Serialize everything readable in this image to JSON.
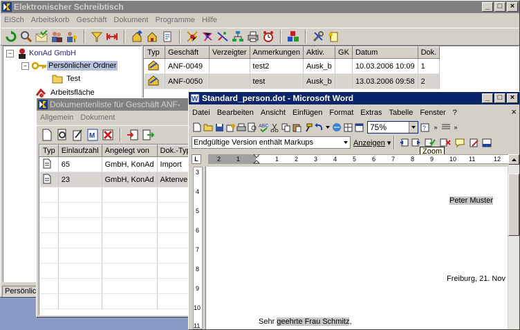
{
  "main_window": {
    "title": "Elektronischer Schreibtisch",
    "menu": [
      "EiSch",
      "Arbeitskorb",
      "Geschäft",
      "Dokument",
      "Programme",
      "Hilfe"
    ],
    "toolbar_icons": [
      "refresh-icon",
      "search-icon",
      "mail-check-icon",
      "users-icon",
      "users-key-icon",
      "filter-icon",
      "expand-width-icon",
      "house-up-icon",
      "house-icon",
      "document-icon",
      "rays-icon",
      "network-icon",
      "network-x-icon",
      "org-chart-icon",
      "printer-icon",
      "alarm-clock-icon",
      "cubes-icon",
      "tools-icon",
      "note-key-icon"
    ],
    "tree": {
      "root": "KonAd GmbH",
      "folder": "Persönlicher Ordner",
      "subfolder": "Test",
      "worksurface": "Arbeitsfläche"
    },
    "status_text": "Persönlic",
    "table": {
      "columns": [
        "Typ",
        "Geschäft",
        "Verzeigter",
        "Anmerkungen",
        "Aktiv.",
        "GK",
        "Datum",
        "Dok."
      ],
      "rows": [
        {
          "geschaeft": "ANF-0049",
          "verzeigter": "",
          "anmerkungen": "test2",
          "aktiv": "Ausk_b",
          "gk": "",
          "datum": "10.03.2006 10:09",
          "dok": "1"
        },
        {
          "geschaeft": "ANF-0050",
          "verzeigter": "",
          "anmerkungen": "test",
          "aktiv": "Ausk_b",
          "gk": "",
          "datum": "13.03.2006 09:58",
          "dok": "2"
        }
      ]
    }
  },
  "doc_window": {
    "title": "Dokumentenliste für Geschäft ANF-",
    "menu": [
      "Allgemein",
      "Dokument"
    ],
    "table": {
      "columns": [
        "Typ",
        "Einlaufzahl",
        "Angelegt von",
        "Dok.-Typ"
      ],
      "rows": [
        {
          "einlaufzahl": "65",
          "angelegt": "GmbH, KonAd",
          "doktyp": "Import"
        },
        {
          "einlaufzahl": "23",
          "angelegt": "GmbH, KonAd",
          "doktyp": "Aktenver"
        }
      ]
    }
  },
  "word_window": {
    "title": "Standard_person.dot - Microsoft Word",
    "menu": [
      "Datei",
      "Bearbeiten",
      "Ansicht",
      "Einfügen",
      "Format",
      "Extras",
      "Tabelle",
      "Fenster",
      "?"
    ],
    "close_doc": "×",
    "zoom_value": "75%",
    "markup_select": "Endgültige Version enthält Markups",
    "show_label": "Anzeigen",
    "tooltip": "Zoom",
    "ruler_tab": "L",
    "ruler_numbers": [
      "2",
      "1",
      "1",
      "2",
      "3",
      "4",
      "5",
      "6",
      "7",
      "8",
      "9",
      "10",
      "11",
      "12"
    ],
    "vruler_numbers": [
      "3",
      "4",
      "5",
      "6",
      "7",
      "8",
      "9",
      "10",
      "11"
    ],
    "doc": {
      "name": "Peter Muster",
      "date": "Freiburg, 21. Nov",
      "salutation_pre": "Sehr ",
      "salutation_field": "geehrte Frau Schmitz",
      "salutation_post": ","
    }
  },
  "colors": {
    "desktop": "#8a9cc6",
    "active_title": "#0a246a",
    "inactive_title": "#808080",
    "tree_highlight": "#b7c0dc",
    "field_shading": "#c6c6c6"
  }
}
